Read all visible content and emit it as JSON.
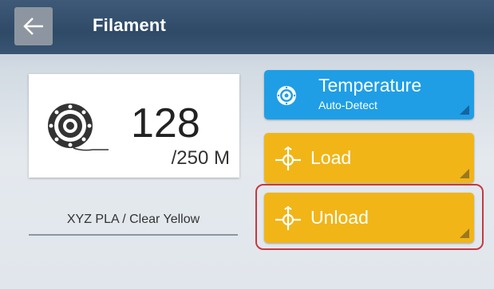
{
  "header": {
    "title": "Filament",
    "back_icon": "arrow-left-icon"
  },
  "spool": {
    "icon": "filament-spool-icon",
    "amount": "128",
    "capacity": "/250 M",
    "material": "XYZ PLA / Clear Yellow"
  },
  "buttons": {
    "temperature": {
      "label": "Temperature",
      "sublabel": "Auto-Detect",
      "icon": "spool-icon",
      "color": "#1f9ee6"
    },
    "load": {
      "label": "Load",
      "icon": "filament-icon",
      "color": "#f2b517"
    },
    "unload": {
      "label": "Unload",
      "icon": "filament-icon",
      "color": "#f2b517",
      "highlighted": true
    }
  },
  "colors": {
    "header": "#2f4a67",
    "highlight": "#c43a40"
  }
}
